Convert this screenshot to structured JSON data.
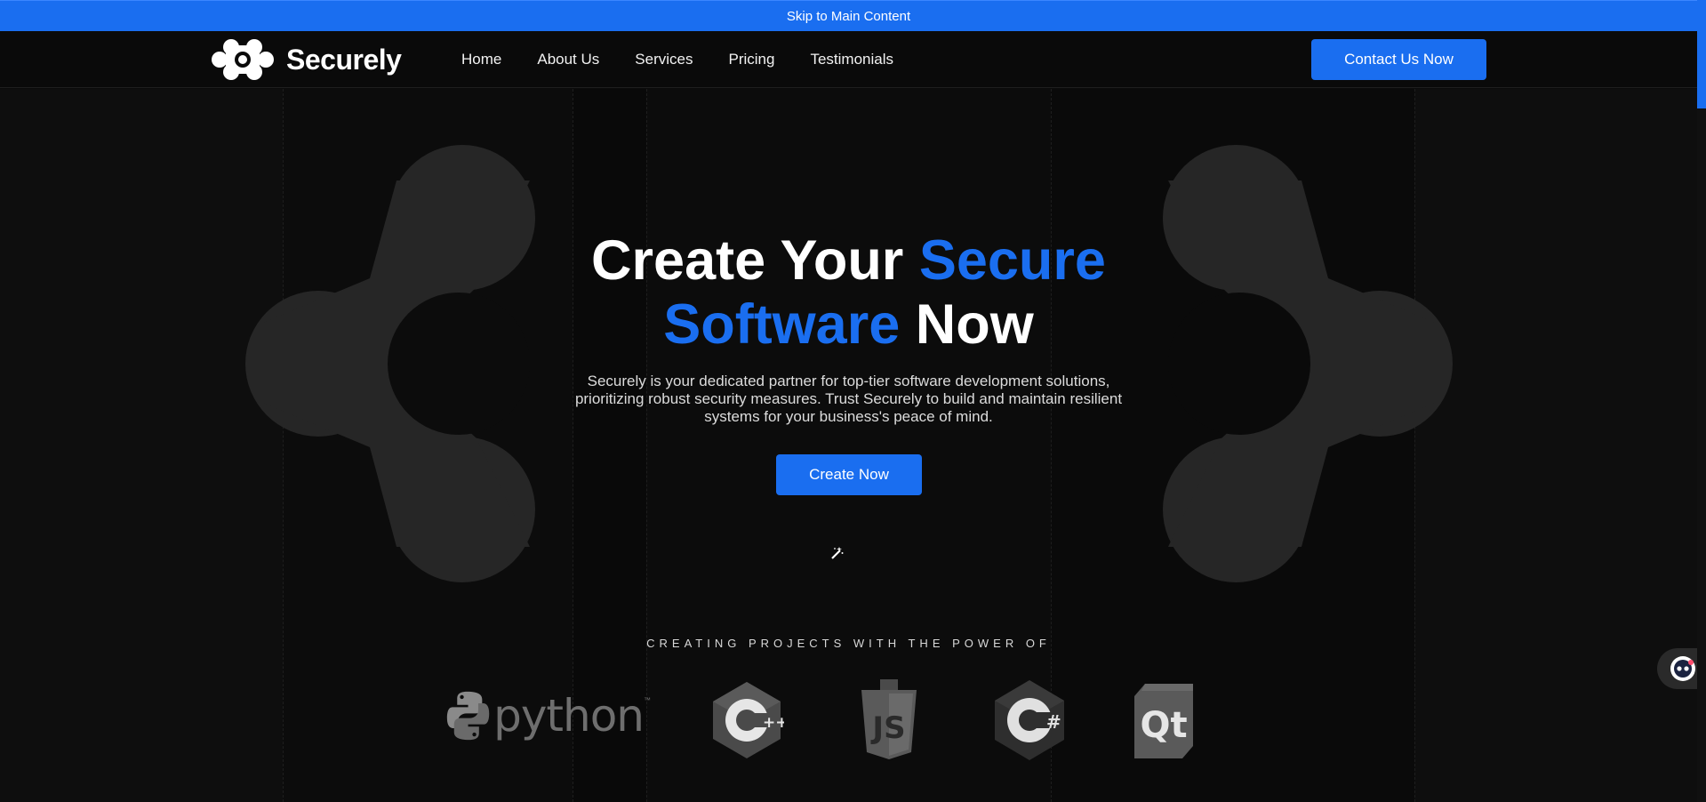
{
  "skip_link": {
    "label": "Skip to Main Content"
  },
  "brand": {
    "name": "Securely",
    "logo_icon": "molecule-logo-icon"
  },
  "nav": {
    "items": [
      {
        "label": "Home"
      },
      {
        "label": "About Us"
      },
      {
        "label": "Services"
      },
      {
        "label": "Pricing"
      },
      {
        "label": "Testimonials"
      }
    ]
  },
  "header": {
    "cta_label": "Contact Us Now"
  },
  "hero": {
    "title_part1": "Create Your ",
    "title_accent1": "Secure",
    "title_accent2": "Software",
    "title_part2": " Now",
    "description": "Securely is your dedicated partner for top-tier software development solutions, prioritizing robust security measures. Trust Securely to build and maintain resilient systems for your business's peace of mind.",
    "cta_label": "Create Now",
    "cursor_icon": "magic-wand-icon"
  },
  "technologies": {
    "label": "CREATING PROJECTS WITH THE POWER OF",
    "python_word": "python",
    "python_tm": "™",
    "cpp_mark": "++",
    "js_mark": "JS",
    "csharp_mark": "#",
    "qt_mark": "Qt",
    "items": [
      "python-logo-icon",
      "cplusplus-logo-icon",
      "javascript-logo-icon",
      "csharp-logo-icon",
      "qt-logo-icon"
    ]
  },
  "chat": {
    "icon": "chat-bot-icon"
  },
  "colors": {
    "accent": "#1a6ef0",
    "background": "#0b0b0b",
    "decor": "#262626"
  }
}
